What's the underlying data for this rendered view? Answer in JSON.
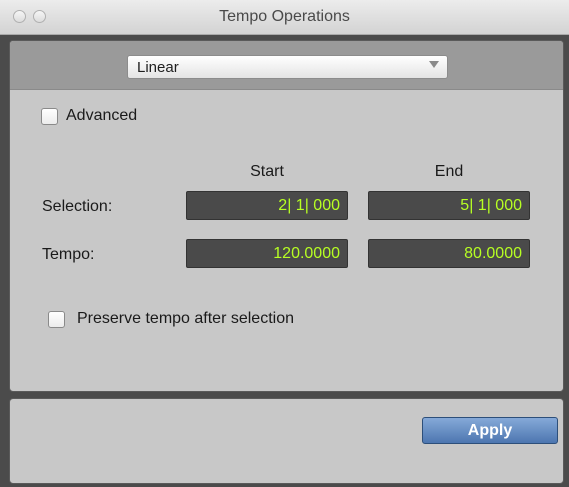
{
  "window": {
    "title": "Tempo Operations"
  },
  "mode_dropdown": {
    "selected": "Linear"
  },
  "advanced_checkbox": {
    "label": "Advanced",
    "checked": false
  },
  "columns": {
    "start": "Start",
    "end": "End"
  },
  "rows": {
    "selection": {
      "label": "Selection:",
      "start": "2| 1| 000",
      "end": "5| 1| 000"
    },
    "tempo": {
      "label": "Tempo:",
      "start": "120.0000",
      "end": "80.0000"
    }
  },
  "preserve_checkbox": {
    "label": "Preserve tempo after selection",
    "checked": false
  },
  "buttons": {
    "apply": "Apply"
  },
  "colors": {
    "field_text": "#b7ff23",
    "field_bg": "#4a4a4a",
    "apply_bg": "#4d76b0"
  }
}
